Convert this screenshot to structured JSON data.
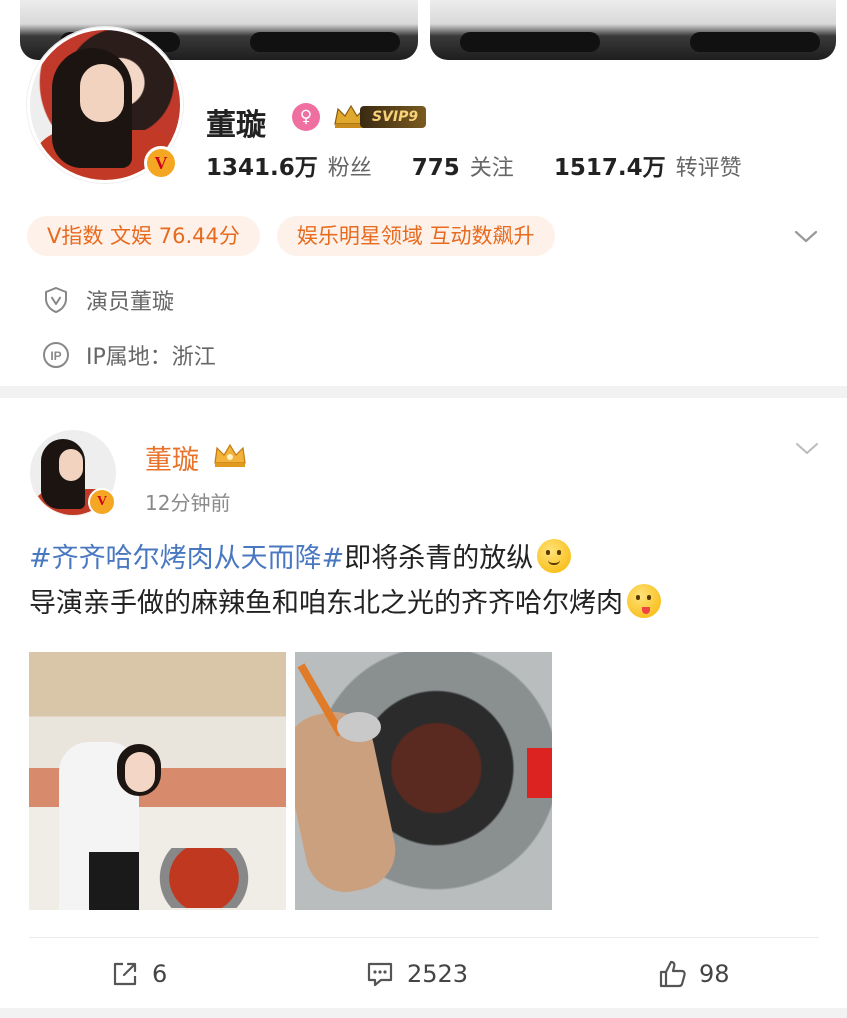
{
  "profile": {
    "name": "董璇",
    "svip_label": "SVIP9",
    "stats": [
      {
        "num": "1341.6万",
        "label": "粉丝"
      },
      {
        "num": "775",
        "label": "关注"
      },
      {
        "num": "1517.4万",
        "label": "转评赞"
      }
    ],
    "tags": [
      "V指数 文娱 76.44分",
      "娱乐明星领域 互动数飙升"
    ],
    "verification": "演员董璇",
    "ip_location": "IP属地：浙江"
  },
  "post": {
    "author": "董璇",
    "time": "12分钟前",
    "hashtag": "#齐齐哈尔烤肉从天而降#",
    "line1_rest": "即将杀青的放纵",
    "line2": "导演亲手做的麻辣鱼和咱东北之光的齐齐哈尔烤肉",
    "actions": {
      "repost_count": "6",
      "comment_count": "2523",
      "like_count": "98"
    }
  },
  "colors": {
    "accent_orange": "#e8722a",
    "hashtag_blue": "#4a78c0",
    "tag_bg": "#fdf1e9"
  }
}
